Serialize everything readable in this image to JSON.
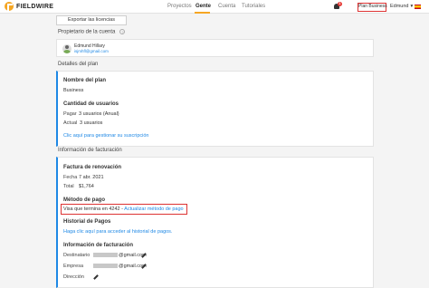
{
  "brand": {
    "name": "FIELDWIRE",
    "accent": "#f5a623"
  },
  "nav": {
    "items": [
      {
        "label": "Proyectos",
        "active": false
      },
      {
        "label": "Gente",
        "active": true
      },
      {
        "label": "Cuenta",
        "active": false
      },
      {
        "label": "Tutoriales",
        "active": false
      }
    ]
  },
  "header": {
    "notification_count": "1",
    "plan_button": "Plan Business",
    "user": "Edmund",
    "user_chevron": "chevron-down-icon"
  },
  "export_button": "Exportar las licencias",
  "owner_section": {
    "title": "Propietario de la cuenta",
    "help": "?",
    "name": "Edmund Hillary",
    "email": "isjmhfl@gmail.com"
  },
  "plan_section": {
    "title": "Detalles del plan",
    "plan_name_label": "Nombre del plan",
    "plan_name": "Business",
    "users_label": "Cantidad de usuarios",
    "pay_key": "Pagar",
    "pay_value": "3 usuarios (Anual)",
    "current_key": "Actual",
    "current_value": "3 usuarios",
    "manage_link": "Clic aquí para gestionar su suscripción"
  },
  "billing_section": {
    "title": "Información de facturación",
    "renewal_label": "Factura de renovación",
    "date_key": "Fecha",
    "date_value": "7 abr. 2021",
    "total_key": "Total",
    "total_value": "$1,764",
    "payment_label": "Método de pago",
    "card_text": "Visa que termina en 4242 - ",
    "update_link": "Actualizar método de pago",
    "history_label": "Historial de Pagos",
    "history_link": "Haga clic aquí para acceder al historial de pagos.",
    "info_label": "Información de facturación",
    "recipient_key": "Destinatario",
    "recipient_value": "@gmail.com",
    "company_key": "Empresa",
    "company_value": "@gmail.com",
    "address_key": "Dirección"
  },
  "colors": {
    "link": "#1e88e5",
    "highlight": "#d33333",
    "badge": "#e53935"
  }
}
